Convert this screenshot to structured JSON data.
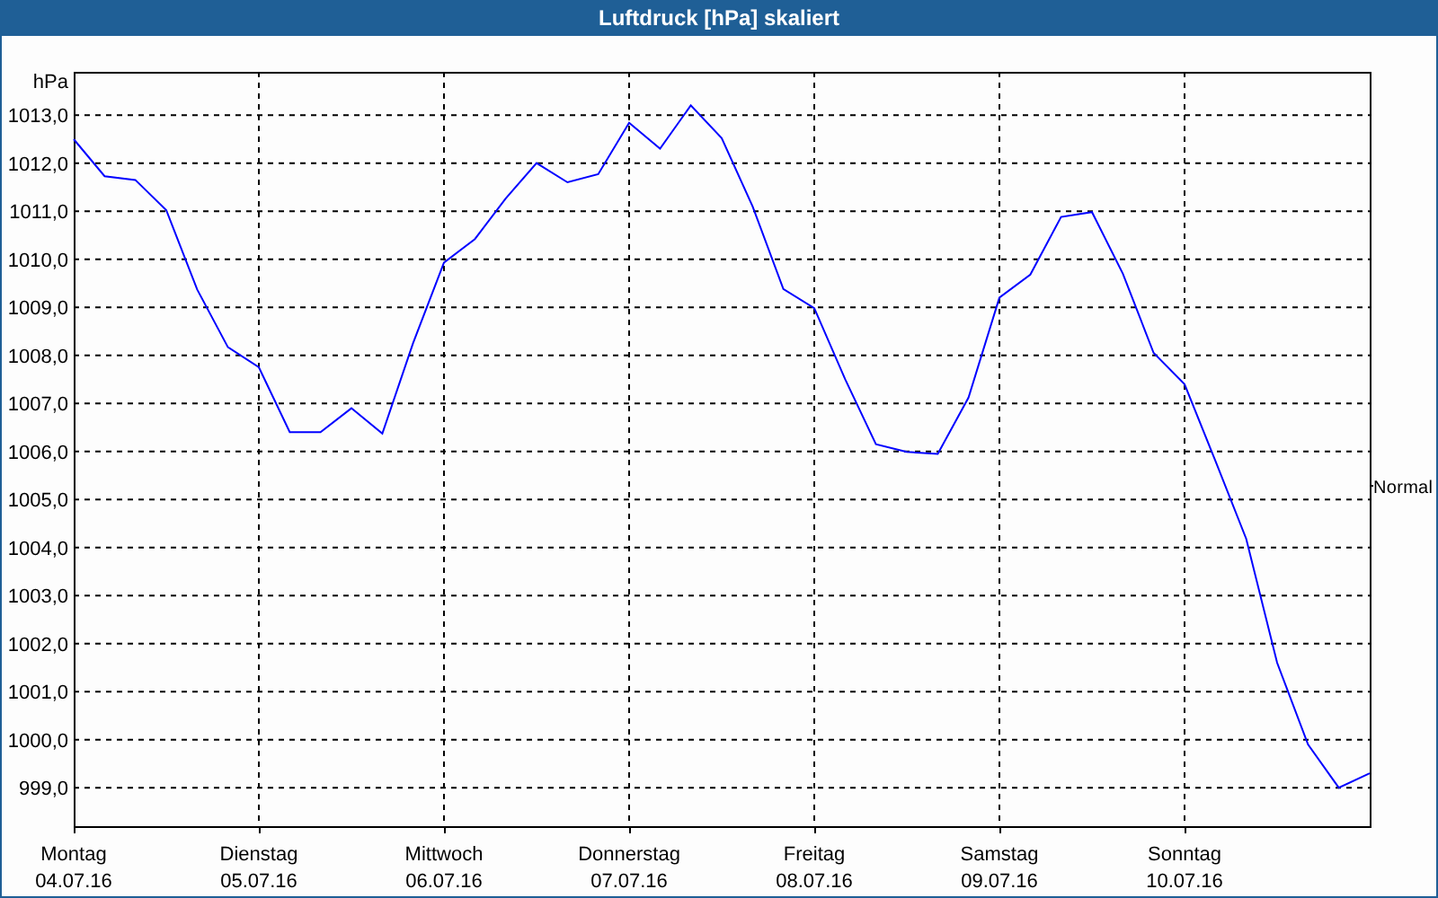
{
  "window": {
    "title": "Luftdruck [hPa] skaliert"
  },
  "chart": {
    "chart_data": {
      "type": "line",
      "ylabel": "hPa",
      "ylim": [
        998.2,
        1013.9
      ],
      "categories": [
        "Montag\n04.07.16",
        null,
        null,
        null,
        null,
        null,
        "Dienstag\n05.07.16",
        null,
        null,
        null,
        null,
        null,
        "Mittwoch\n06.07.16",
        null,
        null,
        null,
        null,
        null,
        "Donnerstag\n07.07.16",
        null,
        null,
        null,
        null,
        null,
        "Freitag\n08.07.16",
        null,
        null,
        null,
        null,
        null,
        "Samstag\n09.07.16",
        null,
        null,
        null,
        null,
        null,
        "Sonntag\n10.07.16",
        null,
        null,
        null,
        null,
        null,
        null
      ],
      "series": [
        {
          "color": "#0000ff",
          "values": [
            1012.5,
            1011.73,
            1011.65,
            1011.02,
            1009.37,
            1008.17,
            1007.75,
            1006.4,
            1006.4,
            1006.9,
            1006.37,
            1008.25,
            1009.93,
            1010.42,
            1011.26,
            1012.0,
            1011.6,
            1011.77,
            1012.84,
            1012.3,
            1013.2,
            1012.52,
            1011.1,
            1009.38,
            1008.98,
            1007.5,
            1006.15,
            1005.99,
            1005.95,
            1007.12,
            1009.2,
            1009.68,
            1010.88,
            1010.98,
            1009.7,
            1008.05,
            1007.4,
            1005.8,
            1004.18,
            1001.6,
            999.9,
            999.0,
            999.3
          ]
        }
      ],
      "yticks": [
        {
          "value": 999,
          "label": "999,0"
        },
        {
          "value": 1000,
          "label": "1000,0"
        },
        {
          "value": 1001,
          "label": "1001,0"
        },
        {
          "value": 1002,
          "label": "1002,0"
        },
        {
          "value": 1003,
          "label": "1003,0"
        },
        {
          "value": 1004,
          "label": "1004,0"
        },
        {
          "value": 1005,
          "label": "1005,0"
        },
        {
          "value": 1006,
          "label": "1006,0"
        },
        {
          "value": 1007,
          "label": "1007,0"
        },
        {
          "value": 1008,
          "label": "1008,0"
        },
        {
          "value": 1009,
          "label": "1009,0"
        },
        {
          "value": 1010,
          "label": "1010,0"
        },
        {
          "value": 1011,
          "label": "1011,0"
        },
        {
          "value": 1012,
          "label": "1012,0"
        },
        {
          "value": 1013,
          "label": "1013,0"
        }
      ],
      "grid": true
    },
    "reference_label": "Normal"
  }
}
